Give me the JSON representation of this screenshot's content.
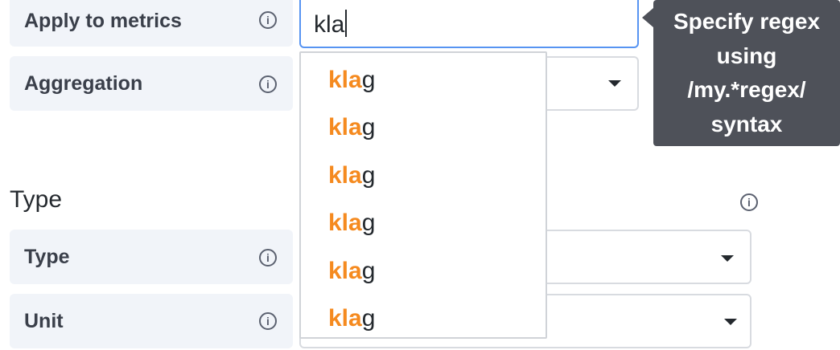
{
  "rows": {
    "apply_to_metrics": {
      "label": "Apply to metrics"
    },
    "aggregation": {
      "label": "Aggregation"
    },
    "type": {
      "label": "Type"
    },
    "unit": {
      "label": "Unit"
    }
  },
  "section": {
    "type_heading": "Type"
  },
  "info_icon_glyph": "i",
  "metrics_input": {
    "value": "kla"
  },
  "suggestions": {
    "items": [
      {
        "match": "kla",
        "rest": "g"
      },
      {
        "match": "kla",
        "rest": "g"
      },
      {
        "match": "kla",
        "rest": "g"
      },
      {
        "match": "kla",
        "rest": "g"
      },
      {
        "match": "kla",
        "rest": "g"
      },
      {
        "match": "kla",
        "rest": "g"
      }
    ]
  },
  "tooltip": {
    "lines": [
      "Specify regex",
      "using",
      "/my.*regex/",
      "syntax"
    ]
  },
  "colors": {
    "match_highlight": "#f58a1f",
    "input_focus_border": "#5794f2",
    "tooltip_bg": "#4e5159",
    "label_bg": "#f1f4f9"
  }
}
